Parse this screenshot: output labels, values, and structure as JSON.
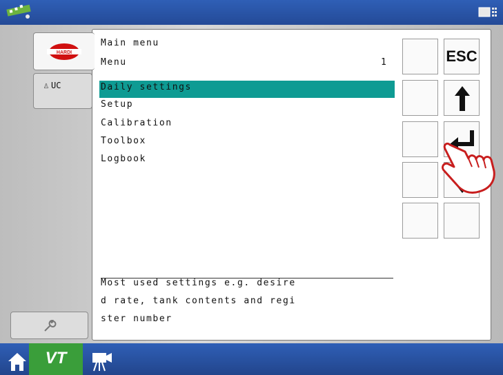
{
  "tabs": {
    "hardi_logo": "HARDI",
    "uc_label": "UC"
  },
  "panel": {
    "main_menu": "Main menu",
    "menu_label": "Menu",
    "menu_number": "1",
    "items": [
      "Daily settings",
      "Setup",
      "Calibration",
      "Toolbox",
      "Logbook"
    ],
    "selected_index": 0,
    "description_lines": [
      "Most used settings e.g. desire",
      "d rate, tank contents and regi",
      "ster number"
    ]
  },
  "softkeys": {
    "esc_label": "ESC"
  },
  "bottom": {
    "vt_label": "VT"
  },
  "colors": {
    "highlight": "#0e9b93",
    "topbar": "#2f5fb6",
    "vt_active": "#3a9e3a"
  }
}
